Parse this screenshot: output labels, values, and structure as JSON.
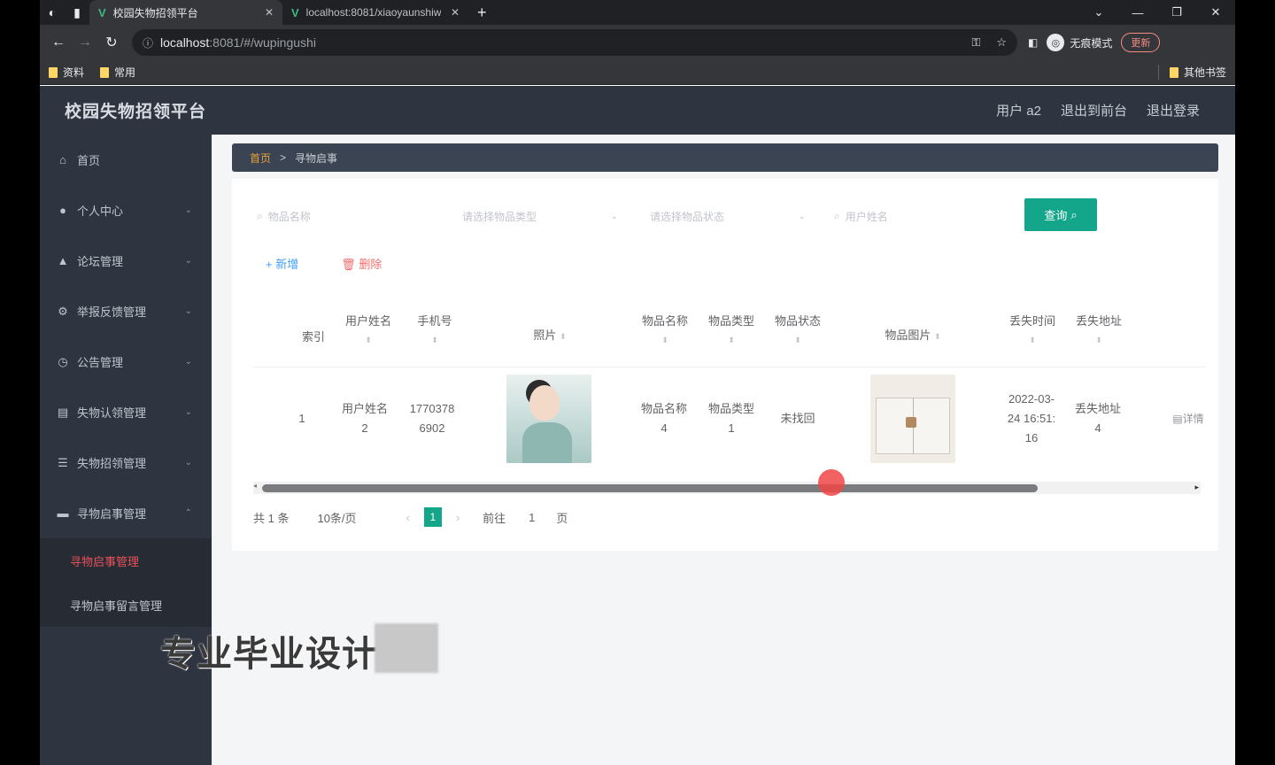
{
  "browser": {
    "tabs": [
      {
        "title": "校园失物招领平台"
      },
      {
        "title": "localhost:8081/xiaoyaunshiw"
      }
    ],
    "url_host": "localhost",
    "url_rest": ":8081/#/wupingushi",
    "profile_label": "无痕模式",
    "update_label": "更新",
    "bookmarks": [
      {
        "label": "资料"
      },
      {
        "label": "常用"
      }
    ],
    "other_bookmarks": "其他书签"
  },
  "app": {
    "title": "校园失物招领平台",
    "header_links": [
      "用户 a2",
      "退出到前台",
      "退出登录"
    ]
  },
  "sidebar": {
    "items": [
      {
        "label": "首页",
        "icon": "home-icon"
      },
      {
        "label": "个人中心",
        "icon": "user-icon"
      },
      {
        "label": "论坛管理",
        "icon": "forum-icon"
      },
      {
        "label": "举报反馈管理",
        "icon": "settings-icon"
      },
      {
        "label": "公告管理",
        "icon": "clock-icon"
      },
      {
        "label": "失物认领管理",
        "icon": "chart-icon"
      },
      {
        "label": "失物招领管理",
        "icon": "list-icon"
      },
      {
        "label": "寻物启事管理",
        "icon": "doc-icon"
      }
    ],
    "sub_items": [
      {
        "label": "寻物启事管理",
        "active": true
      },
      {
        "label": "寻物启事留言管理",
        "active": false
      }
    ]
  },
  "main": {
    "breadcrumb": {
      "home": "首页",
      "sep": ">",
      "current": "寻物启事"
    },
    "search": {
      "f1": "物品名称",
      "f2": "请选择物品类型",
      "f3": "请选择物品状态",
      "f4": "用户姓名",
      "query_label": "查询"
    },
    "actions": {
      "add": "新增",
      "delete": "删除"
    },
    "table": {
      "headers": [
        "索引",
        "用户姓名",
        "手机号",
        "照片",
        "物品名称",
        "物品类型",
        "物品状态",
        "物品图片",
        "丢失时间",
        "丢失地址"
      ],
      "row": {
        "index": "1",
        "user_name": "用户姓名2",
        "phone": "17703786902",
        "item_name": "物品名称4",
        "item_type": "物品类型1",
        "item_status": "未找回",
        "lost_time": "2022-03-24 16:51:16",
        "lost_address": "丢失地址4",
        "op": "详情"
      }
    },
    "pager": {
      "total": "共 1 条",
      "size": "10条/页",
      "current": "1",
      "goto": "前往",
      "page_input": "1",
      "page_unit": "页"
    }
  },
  "overlay": {
    "watermark": "专业毕业设计"
  }
}
